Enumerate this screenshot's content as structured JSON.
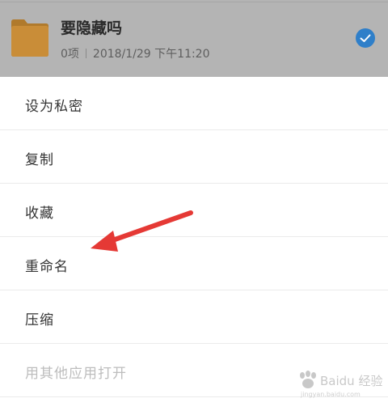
{
  "file": {
    "name": "要隐藏吗",
    "count": "0项",
    "date": "2018/1/29 下午11:20",
    "selected": true,
    "icon": "folder-icon"
  },
  "menu": {
    "items": [
      {
        "label": "设为私密",
        "enabled": true
      },
      {
        "label": "复制",
        "enabled": true
      },
      {
        "label": "收藏",
        "enabled": true
      },
      {
        "label": "重命名",
        "enabled": true
      },
      {
        "label": "压缩",
        "enabled": true
      },
      {
        "label": "用其他应用打开",
        "enabled": false
      }
    ]
  },
  "annotation": {
    "arrow_color": "#e53935",
    "points_to": "重命名"
  },
  "watermark": {
    "text": "Baidu 经验",
    "sub": "jingyan.baidu.com"
  },
  "colors": {
    "folder": "#d79a3f",
    "check": "#3b8fd8",
    "overlay": "#b4b4b4"
  }
}
